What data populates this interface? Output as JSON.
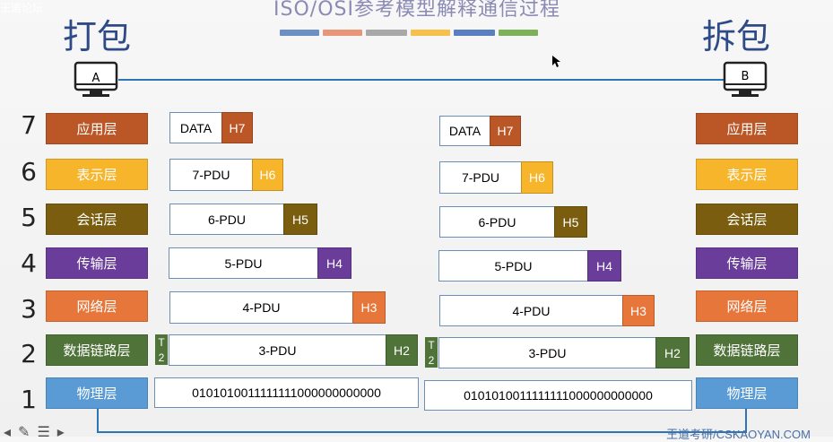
{
  "topbar": {
    "text": "王道论坛"
  },
  "title": {
    "text": "ISO/OSI参考模型解释通信过程"
  },
  "colors": {
    "application": "#bb5626",
    "presentation": "#f6b52a",
    "session": "#7b5d10",
    "transport": "#6a3d9a",
    "network": "#e7763a",
    "datalink": "#4f7339",
    "physical": "#5a9bd5",
    "cable": "#2e75b6",
    "title_bars": [
      "#6b8fc4",
      "#e7967a",
      "#a8a8a8",
      "#f5c04b",
      "#5a7fc1",
      "#7fb05a"
    ]
  },
  "sender": {
    "label": "打包",
    "computer": "A"
  },
  "receiver": {
    "label": "拆包",
    "computer": "B"
  },
  "layers": [
    {
      "num": "7",
      "name": "应用层"
    },
    {
      "num": "6",
      "name": "表示层"
    },
    {
      "num": "5",
      "name": "会话层"
    },
    {
      "num": "4",
      "name": "传输层"
    },
    {
      "num": "3",
      "name": "网络层"
    },
    {
      "num": "2",
      "name": "数据链路层"
    },
    {
      "num": "1",
      "name": "物理层"
    }
  ],
  "pdus": {
    "l7": {
      "data": "DATA",
      "header": "H7"
    },
    "l6": {
      "data": "7-PDU",
      "header": "H6"
    },
    "l5": {
      "data": "6-PDU",
      "header": "H5"
    },
    "l4": {
      "data": "5-PDU",
      "header": "H4"
    },
    "l3": {
      "data": "4-PDU",
      "header": "H3"
    },
    "l2": {
      "data": "3-PDU",
      "header": "H2",
      "trailer_top": "T",
      "trailer_bottom": "2"
    },
    "l1": {
      "bits": "0101010011111111000000000000"
    }
  },
  "footer": {
    "url": "王道考研/CSKAOYAN.COM"
  },
  "toolbar": {
    "icons": [
      "arrow-left-icon",
      "pen-icon",
      "menu-icon",
      "arrow-right-icon"
    ]
  }
}
